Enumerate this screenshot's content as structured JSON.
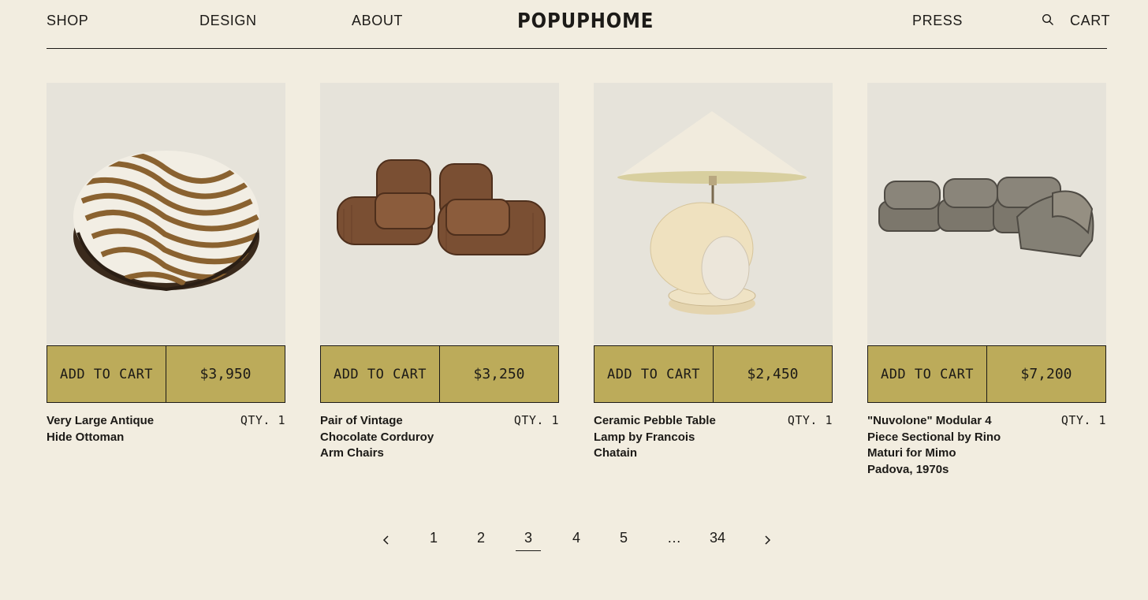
{
  "header": {
    "nav_left": [
      "SHOP",
      "DESIGN",
      "ABOUT"
    ],
    "logo": "POPUPHOME",
    "press": "PRESS",
    "cart": "CART",
    "search_icon": "search-icon"
  },
  "products": [
    {
      "title": "Very Large Antique Hide Ottoman",
      "add_label": "ADD TO CART",
      "price": "$3,950",
      "qty": "QTY. 1"
    },
    {
      "title": "Pair of Vintage Chocolate Corduroy Arm Chairs",
      "add_label": "ADD TO CART",
      "price": "$3,250",
      "qty": "QTY. 1"
    },
    {
      "title": "Ceramic Pebble Table Lamp by Francois Chatain",
      "add_label": "ADD TO CART",
      "price": "$2,450",
      "qty": "QTY. 1"
    },
    {
      "title": "\"Nuvolone\" Modular 4 Piece Sectional by Rino Maturi for Mimo Padova, 1970s",
      "add_label": "ADD TO CART",
      "price": "$7,200",
      "qty": "QTY. 1"
    }
  ],
  "pagination": {
    "pages": [
      "1",
      "2",
      "3",
      "4",
      "5",
      "…",
      "34"
    ],
    "current": "3"
  },
  "colors": {
    "background": "#f2ede0",
    "image_bg": "#e6e3da",
    "button_fill": "#bcab5a",
    "ink": "#1c1a17"
  }
}
